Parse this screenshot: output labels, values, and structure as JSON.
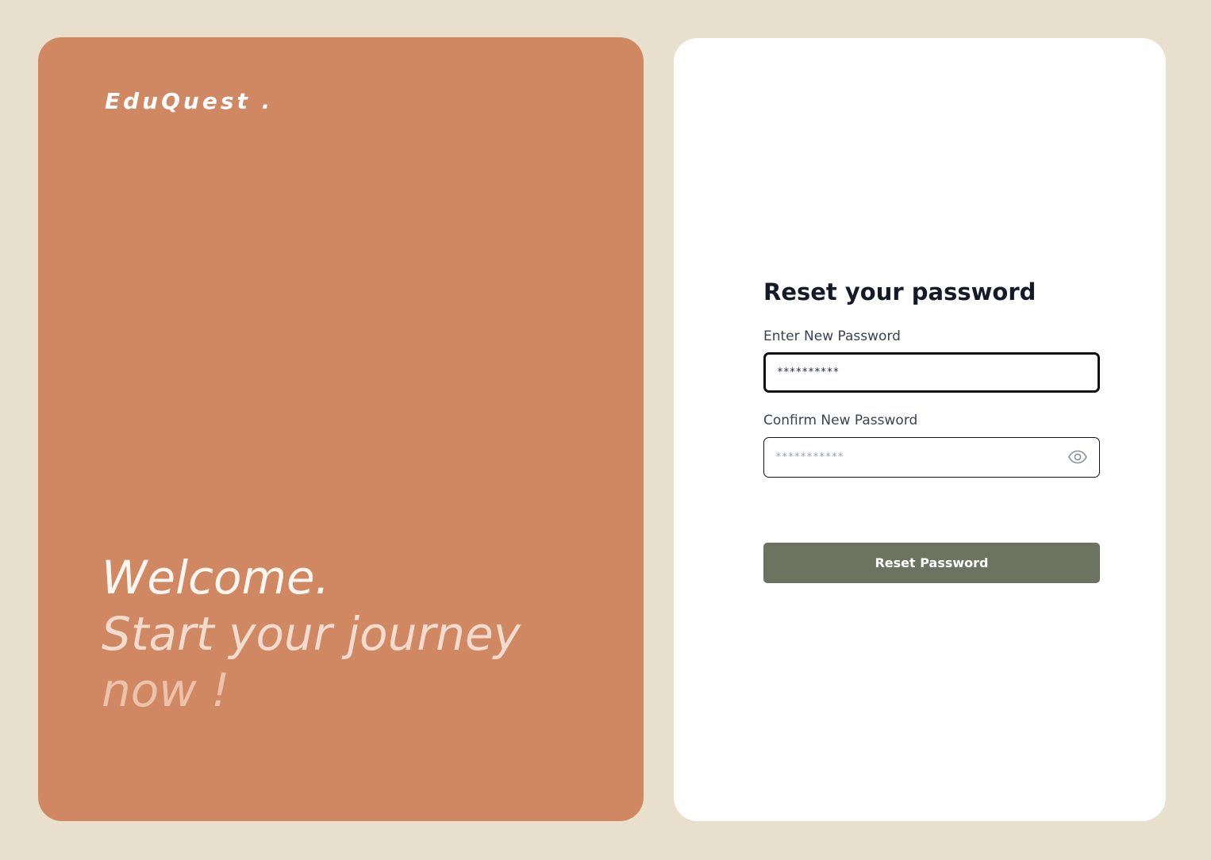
{
  "brand": {
    "name": "EduQuest ."
  },
  "hero": {
    "line1": "Welcome.",
    "line2": "Start your journey",
    "line3": "now !"
  },
  "form": {
    "title": "Reset your password",
    "new_password": {
      "label": "Enter New Password",
      "value": "**********"
    },
    "confirm_password": {
      "label": "Confirm New Password",
      "placeholder": "***********",
      "toggle_icon": "eye-icon"
    },
    "submit_label": "Reset Password"
  },
  "colors": {
    "page_background": "#e8e0cd",
    "hero_panel": "#cf8862",
    "form_panel": "#ffffff",
    "button": "#6e7361",
    "title_text": "#141a27"
  }
}
